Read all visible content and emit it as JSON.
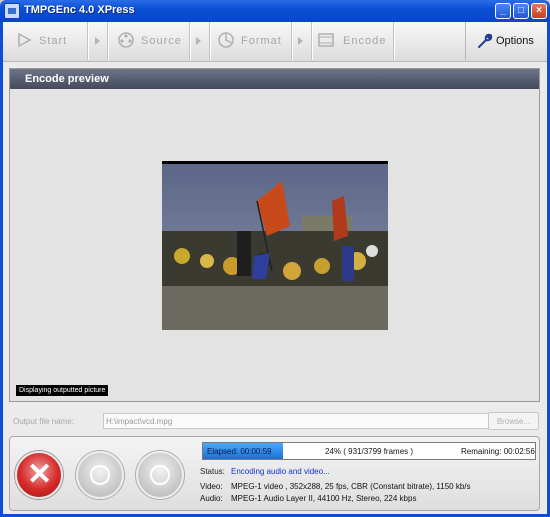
{
  "window": {
    "title": "TMPGEnc 4.0 XPress"
  },
  "toolbar": {
    "steps": [
      {
        "label": "Start",
        "icon": "play-icon"
      },
      {
        "label": "Source",
        "icon": "film-reel-icon"
      },
      {
        "label": "Format",
        "icon": "format-icon"
      },
      {
        "label": "Encode",
        "icon": "film-strip-icon"
      }
    ],
    "options_label": "Options"
  },
  "panel": {
    "title": "Encode preview",
    "overlay_text": "Displaying outputted picture"
  },
  "output": {
    "label": "Output file name:",
    "value": "H:\\impact\\vcd.mpg",
    "browse_label": "Browse..."
  },
  "progress": {
    "elapsed": "Elapsed: 00:00:59",
    "percent_text": "24% ( 931/3799  frames )",
    "remaining": "Remaining: 00:02:56",
    "fraction": 0.24
  },
  "status": {
    "label": "Status:",
    "value": "Encoding audio and video..."
  },
  "video": {
    "label": "Video:",
    "value": "MPEG-1 video , 352x288, 25 fps, CBR (Constant bitrate), 1150 kb/s"
  },
  "audio": {
    "label": "Audio:",
    "value": "MPEG-1 Audio Layer II, 44100 Hz, Stereo, 224 kbps"
  },
  "colors": {
    "accent": "#0a4fd6",
    "cancel": "#d62a2a",
    "progress": "#1c6fd1",
    "status_text": "#1033cc"
  }
}
